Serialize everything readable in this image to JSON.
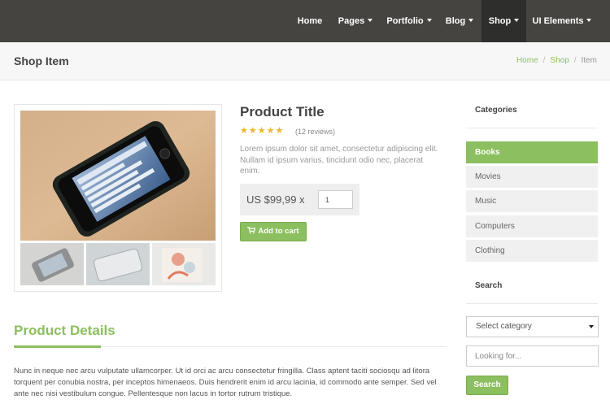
{
  "navbar": {
    "items": [
      {
        "label": "Home"
      },
      {
        "label": "Pages"
      },
      {
        "label": "Portfolio"
      },
      {
        "label": "Blog"
      },
      {
        "label": "Shop"
      },
      {
        "label": "UI Elements"
      }
    ],
    "active": "Shop"
  },
  "page_header": {
    "title": "Shop Item",
    "breadcrumb": [
      "Home",
      "Shop",
      "Item"
    ],
    "separator": "/"
  },
  "product": {
    "title": "Product Title",
    "stars": "★★★★★",
    "rating": 5,
    "reviews": "(12 reviews)",
    "description": "Lorem ipsum dolor sit amet, consectetur adipiscing elit. Nullam id ipsum varius, tincidunt odio nec, placerat enim.",
    "price": "US $99,99 x",
    "quantity": "1",
    "add_to_cart": "Add to cart",
    "cart_icon": "shopping-cart-icon",
    "images": {
      "main": "smartphone-on-wooden-table",
      "thumbnails": [
        "smartphone-thumbnail",
        "silver-laptop-thumbnail",
        "notebook-cover-thumbnail"
      ]
    }
  },
  "details": {
    "title": "Product Details",
    "text": "Nunc in neque nec arcu vulputate ullamcorper. Ut id orci ac arcu consectetur fringilla. Class aptent taciti sociosqu ad litora torquent per conubia nostra, per inceptos himenaeos. Duis hendrerit enim id arcu lacinia, id commodo ante semper. Sed vel ante nec nisi vestibulum congue. Pellentesque non lacus in tortor rutrum tristique."
  },
  "sidebar": {
    "categories_heading": "Categories",
    "categories": [
      "Books",
      "Movies",
      "Music",
      "Computers",
      "Clothing"
    ],
    "active_category": "Books",
    "search_heading": "Search",
    "select_value": "Select category",
    "search_placeholder": "Looking for...",
    "search_button": "Search"
  },
  "colors": {
    "accent": "#8cbf5f",
    "navbar": "#454441",
    "navbar_active": "#2e2e2c",
    "stars": "#f0b429"
  }
}
